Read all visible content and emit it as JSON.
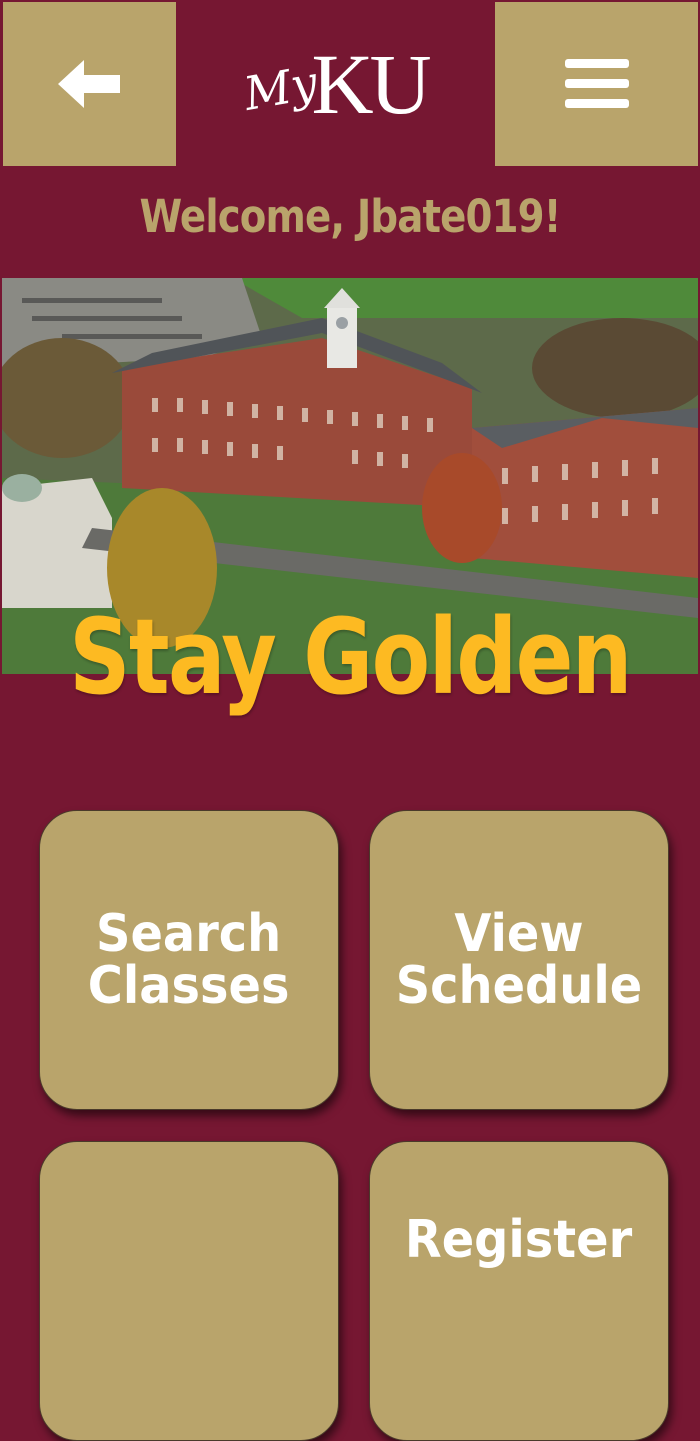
{
  "header": {
    "back_icon": "arrow-left-icon",
    "menu_icon": "hamburger-menu-icon",
    "logo_my": "My",
    "logo_ku": "KU"
  },
  "welcome_text": "Welcome, Jbate019!",
  "hero": {
    "slogan": "Stay Golden"
  },
  "tiles": [
    {
      "label": "Search\nClasses"
    },
    {
      "label": "View\nSchedule"
    },
    {
      "label": ""
    },
    {
      "label": "Register"
    }
  ],
  "colors": {
    "maroon": "#761732",
    "gold": "#b9a46b",
    "slogan_yellow": "#fdba22",
    "white": "#ffffff"
  }
}
